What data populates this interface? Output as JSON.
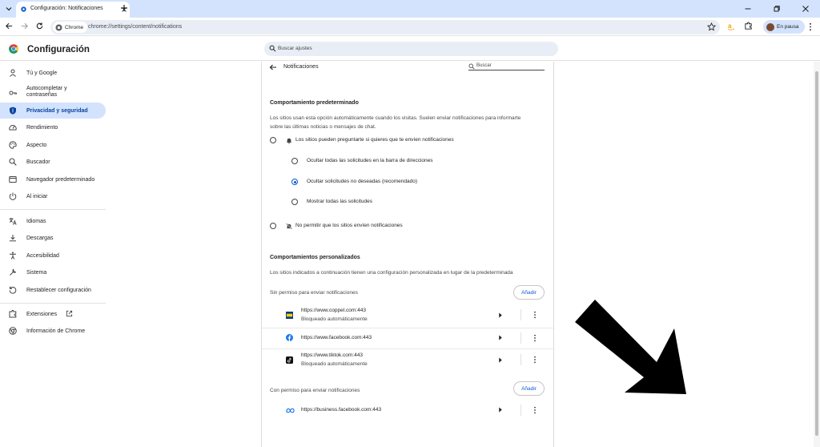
{
  "browser": {
    "tab_title": "Configuración: Notificaciones",
    "chip_label": "Chrome",
    "url": "chrome://settings/content/notifications",
    "profile_label": "En pausa"
  },
  "header": {
    "title": "Configuración",
    "search_placeholder": "Buscar ajustes"
  },
  "sidebar": {
    "items": [
      {
        "label": "Tú y Google",
        "icon": "person-icon"
      },
      {
        "label": "Autocompletar y contraseñas",
        "icon": "key-icon"
      },
      {
        "label": "Privacidad y seguridad",
        "icon": "shield-icon",
        "active": true
      },
      {
        "label": "Rendimiento",
        "icon": "speedometer-icon"
      },
      {
        "label": "Aspecto",
        "icon": "palette-icon"
      },
      {
        "label": "Buscador",
        "icon": "search-icon"
      },
      {
        "label": "Navegador predeterminado",
        "icon": "browser-icon"
      },
      {
        "label": "Al iniciar",
        "icon": "power-icon"
      },
      {
        "label": "Idiomas",
        "icon": "translate-icon"
      },
      {
        "label": "Descargas",
        "icon": "download-icon"
      },
      {
        "label": "Accesibilidad",
        "icon": "accessibility-icon"
      },
      {
        "label": "Sistema",
        "icon": "wrench-icon"
      },
      {
        "label": "Restablecer configuración",
        "icon": "reset-icon"
      },
      {
        "label": "Extensiones",
        "icon": "puzzle-icon"
      },
      {
        "label": "Información de Chrome",
        "icon": "chrome-icon"
      }
    ]
  },
  "main": {
    "page_title": "Notificaciones",
    "search_placeholder": "Buscar",
    "default_section": {
      "heading": "Comportamiento predeterminado",
      "description_line1": "Los sitios usan esta opción automáticamente cuando los visitas. Suelen enviar notificaciones para informarte",
      "description_line2": "sobre las últimas noticias o mensajes de chat.",
      "option_allow_ask": "Los sitios pueden preguntarte si quieres que te envíen notificaciones",
      "sub_options": [
        "Ocultar todas las solicitudes en la barra de direcciones",
        "Ocultar solicitudes no deseadas (recomendado)",
        "Mostrar todas las solicitudes"
      ],
      "selected_sub_option": 1,
      "option_block": "No permitir que los sitios envíen notificaciones"
    },
    "custom_section": {
      "heading": "Comportamientos personalizados",
      "description": "Los sitios indicados a continuación tienen una configuración personalizada en lugar de la predeterminada",
      "blocked_label": "Sin permiso para enviar notificaciones",
      "allowed_label": "Con permiso para enviar notificaciones",
      "add_button": "Añadir",
      "blocked_sites": [
        {
          "url": "https://www.coppel.com:443",
          "status": "Bloqueado automáticamente",
          "icon": "coppel-icon"
        },
        {
          "url": "https://www.facebook.com:443",
          "status": "",
          "icon": "facebook-icon"
        },
        {
          "url": "https://www.tiktok.com:443",
          "status": "Bloqueado automáticamente",
          "icon": "tiktok-icon"
        }
      ],
      "allowed_sites": [
        {
          "url": "https://business.facebook.com:443",
          "icon": "meta-icon"
        }
      ]
    }
  },
  "colors": {
    "accent": "#0b57d0",
    "active_nav": "#d3e3fd",
    "tabstrip": "#d3e3fd"
  }
}
